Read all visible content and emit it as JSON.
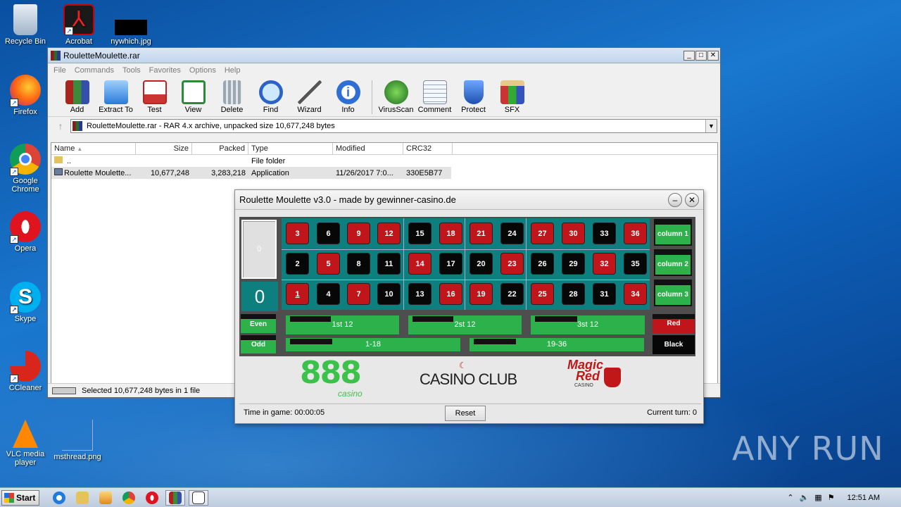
{
  "desktop": {
    "icons": [
      {
        "label": "Recycle Bin"
      },
      {
        "label": "Acrobat"
      },
      {
        "label": "nywhich.jpg"
      },
      {
        "label": "Firefox"
      },
      {
        "label": "Google Chrome"
      },
      {
        "label": "Opera"
      },
      {
        "label": "Skype"
      },
      {
        "label": "CCleaner"
      },
      {
        "label": "VLC media player"
      },
      {
        "label": "msthread.png"
      }
    ],
    "watermark": "ANY RUN"
  },
  "winrar": {
    "title": "RouletteMoulette.rar",
    "menu": [
      "File",
      "Commands",
      "Tools",
      "Favorites",
      "Options",
      "Help"
    ],
    "toolbar": [
      "Add",
      "Extract To",
      "Test",
      "View",
      "Delete",
      "Find",
      "Wizard",
      "Info",
      "VirusScan",
      "Comment",
      "Protect",
      "SFX"
    ],
    "address": "RouletteMoulette.rar - RAR 4.x archive, unpacked size 10,677,248 bytes",
    "columns": [
      "Name",
      "Size",
      "Packed",
      "Type",
      "Modified",
      "CRC32"
    ],
    "rows": [
      {
        "name": "..",
        "size": "",
        "packed": "",
        "type": "File folder",
        "modified": "",
        "crc": ""
      },
      {
        "name": "Roulette Moulette...",
        "size": "10,677,248",
        "packed": "3,283,218",
        "type": "Application",
        "modified": "11/26/2017 7:0...",
        "crc": "330E5B77"
      }
    ],
    "status": "Selected 10,677,248 bytes in 1 file"
  },
  "roulette": {
    "title": "Roulette Moulette v3.0 - made by gewinner-casino.de",
    "zero_small": "0",
    "zero_big": "0",
    "rows": [
      [
        {
          "n": "3",
          "c": "red"
        },
        {
          "n": "6",
          "c": "black"
        },
        {
          "n": "9",
          "c": "red"
        },
        {
          "n": "12",
          "c": "red"
        },
        {
          "n": "15",
          "c": "black"
        },
        {
          "n": "18",
          "c": "red"
        },
        {
          "n": "21",
          "c": "red"
        },
        {
          "n": "24",
          "c": "black"
        },
        {
          "n": "27",
          "c": "red"
        },
        {
          "n": "30",
          "c": "red"
        },
        {
          "n": "33",
          "c": "black"
        },
        {
          "n": "36",
          "c": "red"
        }
      ],
      [
        {
          "n": "2",
          "c": "black"
        },
        {
          "n": "5",
          "c": "red"
        },
        {
          "n": "8",
          "c": "black"
        },
        {
          "n": "11",
          "c": "black"
        },
        {
          "n": "14",
          "c": "red"
        },
        {
          "n": "17",
          "c": "black"
        },
        {
          "n": "20",
          "c": "black"
        },
        {
          "n": "23",
          "c": "red"
        },
        {
          "n": "26",
          "c": "black"
        },
        {
          "n": "29",
          "c": "black"
        },
        {
          "n": "32",
          "c": "red"
        },
        {
          "n": "35",
          "c": "black"
        }
      ],
      [
        {
          "n": "1",
          "c": "red"
        },
        {
          "n": "4",
          "c": "black"
        },
        {
          "n": "7",
          "c": "red"
        },
        {
          "n": "10",
          "c": "black"
        },
        {
          "n": "13",
          "c": "black"
        },
        {
          "n": "16",
          "c": "red"
        },
        {
          "n": "19",
          "c": "red"
        },
        {
          "n": "22",
          "c": "black"
        },
        {
          "n": "25",
          "c": "red"
        },
        {
          "n": "28",
          "c": "black"
        },
        {
          "n": "31",
          "c": "black"
        },
        {
          "n": "34",
          "c": "red"
        }
      ]
    ],
    "columns": [
      "column 1",
      "column 2",
      "column 3"
    ],
    "even": "Even",
    "odd": "Odd",
    "dozens": [
      "1st 12",
      "2st 12",
      "3st 12"
    ],
    "halves": [
      "1-18",
      "19-36"
    ],
    "red": "Red",
    "black": "Black",
    "logos": {
      "l888": "888",
      "l888sub": "casino",
      "casino_club": "CASINO CLUB",
      "magic_red_1": "Magic",
      "magic_red_2": "Red",
      "magic_red_3": "CASINO"
    },
    "time": "Time in game: 00:00:05",
    "reset": "Reset",
    "turn": "Current turn: 0"
  },
  "taskbar": {
    "start": "Start",
    "clock": "12:51 AM"
  },
  "colors": {
    "red": "#c0151a",
    "black": "#070707",
    "felt": "#0d7f7f",
    "green": "#2db14a"
  }
}
